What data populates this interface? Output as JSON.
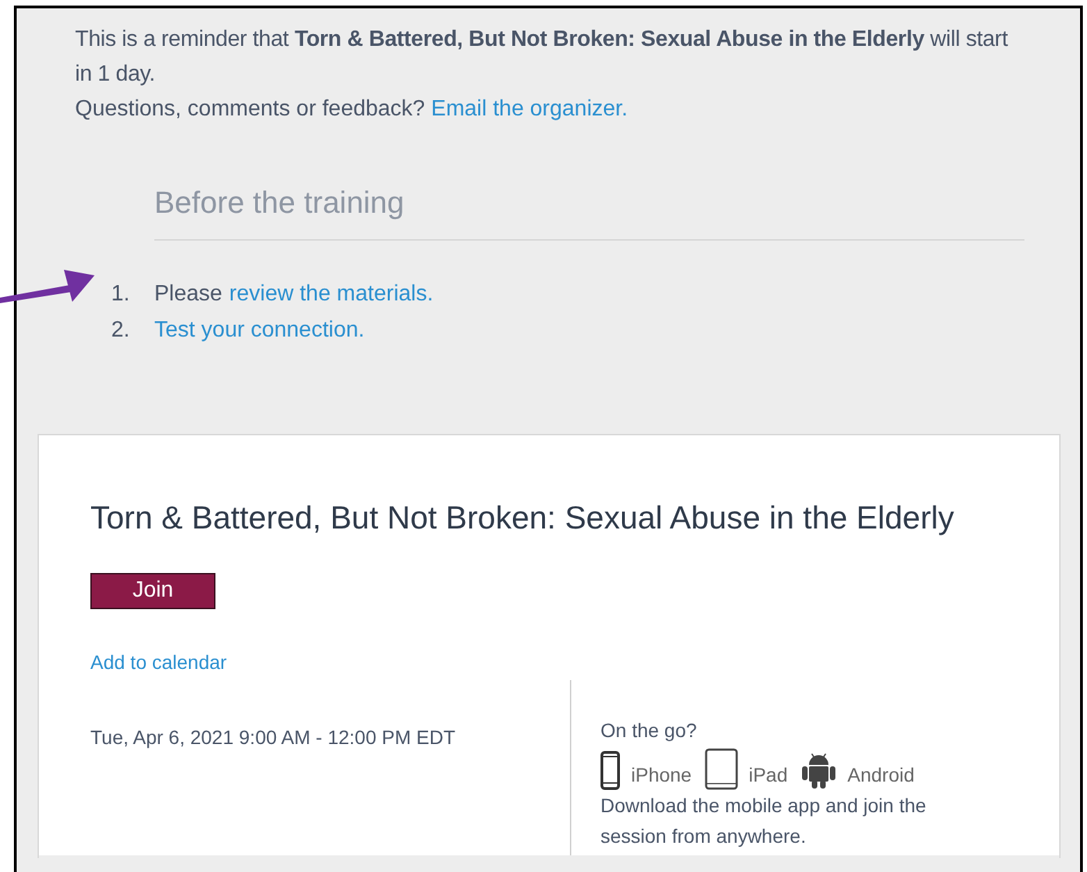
{
  "reminder": {
    "text": "This is a reminder that **Torn & Battered, But Not Broken: Sexual Abuse in the Elderly** will start in 1 day.",
    "question": "Questions, comments or feedback?",
    "link": "Email the organizer."
  },
  "before": {
    "heading": "Before the training",
    "steps": [
      {
        "number": "1.",
        "text": "Please",
        "link": "review the materials."
      },
      {
        "number": "2.",
        "link": "Test your connection."
      }
    ]
  },
  "event": {
    "title": "Torn & Battered, But Not Broken: Sexual Abuse in the Elderly",
    "join": "Join",
    "calendar": "Add to calendar",
    "when": "Tue, Apr 6, 2021 9:00 AM - 12:00 PM EDT",
    "mobile": {
      "heading": "On the go?",
      "apps": [
        {
          "kind": "phone",
          "label": "iPhone"
        },
        {
          "kind": "tablet",
          "label": "iPad"
        },
        {
          "kind": "android",
          "label": "Android"
        }
      ],
      "note": "Download the mobile app and join the session from anywhere."
    }
  }
}
